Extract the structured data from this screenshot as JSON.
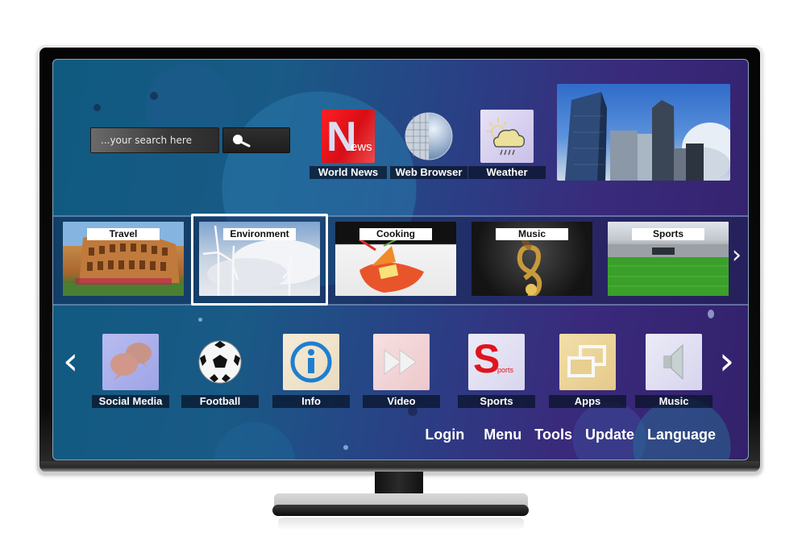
{
  "search": {
    "placeholder": "...your search here",
    "button_icon": "search-icon"
  },
  "top_apps": [
    {
      "label": "World News",
      "icon": "news-icon",
      "icon_text_big": "N",
      "icon_text_small": "ews"
    },
    {
      "label": "Web Browser",
      "icon": "globe-icon"
    },
    {
      "label": "Weather",
      "icon": "weather-icon"
    }
  ],
  "featured_image": "city-skyline",
  "categories": [
    {
      "label": "Travel",
      "image": "colosseum"
    },
    {
      "label": "Environment",
      "image": "wind-turbines",
      "selected": true
    },
    {
      "label": "Cooking",
      "image": "food-dish"
    },
    {
      "label": "Music",
      "image": "treble-clef"
    },
    {
      "label": "Sports",
      "image": "stadium"
    }
  ],
  "categories_next": "›",
  "bottom_apps": [
    {
      "label": "Social Media",
      "icon": "chat-bubbles-icon"
    },
    {
      "label": "Football",
      "icon": "soccer-ball-icon"
    },
    {
      "label": "Info",
      "icon": "info-icon"
    },
    {
      "label": "Video",
      "icon": "fast-forward-icon"
    },
    {
      "label": "Sports",
      "icon": "sports-logo-icon",
      "icon_text_big": "S",
      "icon_text_small": "ports"
    },
    {
      "label": "Apps",
      "icon": "windows-icon"
    },
    {
      "label": "Music",
      "icon": "speaker-icon"
    }
  ],
  "bottom_prev": "‹",
  "bottom_next": "›",
  "menu": [
    "Login",
    "Menu",
    "Tools",
    "Update",
    "Language"
  ],
  "colors": {
    "news_red": "#e8141c",
    "sports_red": "#e0141c",
    "info_blue": "#1e7fd0",
    "apps_tan": "#ecd79e",
    "selection_border": "#ffffff"
  }
}
